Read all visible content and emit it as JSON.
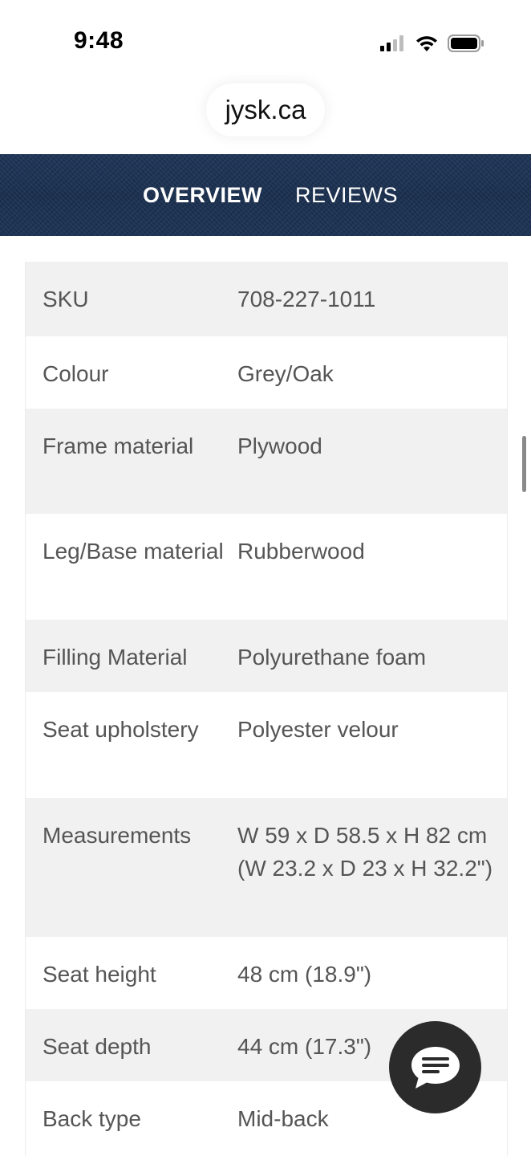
{
  "status_bar": {
    "time": "9:48",
    "icons": [
      "signal-icon",
      "wifi-icon",
      "battery-icon"
    ]
  },
  "browser": {
    "url": "jysk.ca"
  },
  "tabs": [
    {
      "label": "OVERVIEW",
      "active": true
    },
    {
      "label": "REVIEWS",
      "active": false
    }
  ],
  "specs": [
    {
      "label": "SKU",
      "value": "708-227-1011"
    },
    {
      "label": "Colour",
      "value": "Grey/Oak"
    },
    {
      "label": "Frame material",
      "value": "Plywood"
    },
    {
      "label": "Leg/Base material",
      "value": "Rubberwood"
    },
    {
      "label": "Filling Material",
      "value": "Polyurethane foam"
    },
    {
      "label": "Seat upholstery",
      "value": "Polyester velour"
    },
    {
      "label": "Measurements",
      "value": "W 59 x D 58.5 x H 82 cm (W 23.2 x D 23 x H 32.2\")"
    },
    {
      "label": "Seat height",
      "value": "48 cm (18.9\")"
    },
    {
      "label": "Seat depth",
      "value": "44 cm (17.3\")"
    },
    {
      "label": "Back type",
      "value": "Mid-back"
    }
  ],
  "chat": {
    "icon": "chat-bubble-icon"
  },
  "colors": {
    "tab_bar_bg": "#1c3254",
    "row_alt_bg": "#f1f1f1",
    "chat_button_bg": "#2b2b2b"
  }
}
